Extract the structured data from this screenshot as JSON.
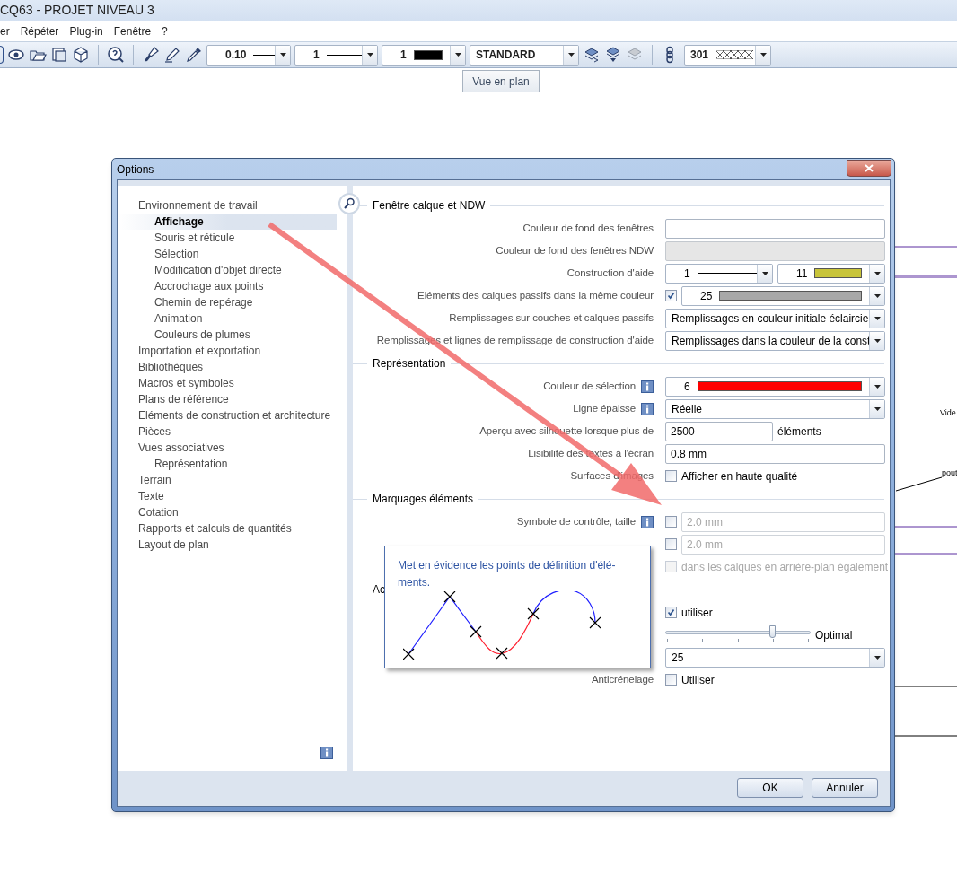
{
  "app": {
    "title": "CQ63 - PROJET NIVEAU 3"
  },
  "menu": [
    "er",
    "Répéter",
    "Plug-in",
    "Fenêtre",
    "?"
  ],
  "toolbar_combos": [
    {
      "value": "0.10",
      "line_sample": true
    },
    {
      "value": "1",
      "line_sample": true
    },
    {
      "value": "1",
      "color": "#000000"
    },
    {
      "value": "STANDARD"
    },
    {
      "value": "301",
      "hatched": true
    }
  ],
  "tooltip": {
    "text": "Vue en plan"
  },
  "canvas_labels": [
    "Vide",
    "pout"
  ],
  "dialog": {
    "title": "Options",
    "tree": [
      {
        "label": "Environnement de travail",
        "selected": false,
        "children": [
          {
            "label": "Affichage",
            "selected": true
          },
          {
            "label": "Souris et réticule",
            "selected": false
          },
          {
            "label": "Sélection",
            "selected": false
          },
          {
            "label": "Modification d'objet directe",
            "selected": false
          },
          {
            "label": "Accrochage aux points",
            "selected": false
          },
          {
            "label": "Chemin de repérage",
            "selected": false
          },
          {
            "label": "Animation",
            "selected": false
          },
          {
            "label": "Couleurs de plumes",
            "selected": false
          }
        ]
      },
      {
        "label": "Importation et exportation",
        "selected": false
      },
      {
        "label": "Bibliothèques",
        "selected": false
      },
      {
        "label": "Macros et symboles",
        "selected": false
      },
      {
        "label": "Plans de référence",
        "selected": false
      },
      {
        "label": "Eléments de construction et architecture",
        "selected": false
      },
      {
        "label": "Pièces",
        "selected": false
      },
      {
        "label": "Vues associatives",
        "selected": false,
        "children": [
          {
            "label": "Représentation",
            "selected": false
          }
        ]
      },
      {
        "label": "Terrain",
        "selected": false
      },
      {
        "label": "Texte",
        "selected": false
      },
      {
        "label": "Cotation",
        "selected": false
      },
      {
        "label": "Rapports et calculs de quantités",
        "selected": false
      },
      {
        "label": "Layout de plan",
        "selected": false
      }
    ],
    "sections": [
      {
        "title": "Fenêtre calque et NDW",
        "rows": [
          {
            "label": "Couleur de fond des fenêtres",
            "controls": [
              {
                "kind": "field",
                "disabled": false
              }
            ]
          },
          {
            "label": "Couleur de fond des fenêtres NDW",
            "controls": [
              {
                "kind": "field",
                "disabled": true
              }
            ]
          },
          {
            "label": "Construction d'aide",
            "controls": [
              {
                "kind": "combo",
                "value": "1",
                "line_sample": true
              },
              {
                "kind": "combo",
                "value": "11",
                "color": "#c8c43a"
              }
            ]
          },
          {
            "label": "Eléments des calques passifs dans la même couleur",
            "controls": [
              {
                "kind": "checkbox",
                "checked": true,
                "disabled": false
              },
              {
                "kind": "combo",
                "value": "25",
                "color": "#a8a8a8"
              }
            ]
          },
          {
            "label": "Remplissages sur couches et calques passifs",
            "controls": [
              {
                "kind": "combo",
                "value": "Remplissages en couleur initiale éclaircie"
              }
            ]
          },
          {
            "label": "Remplissages et lignes de remplissage de construction d'aide",
            "controls": [
              {
                "kind": "combo",
                "value": "Remplissages dans la couleur de la const"
              }
            ]
          }
        ]
      },
      {
        "title": "Représentation",
        "rows": [
          {
            "label": "Couleur de sélection",
            "info": true,
            "controls": [
              {
                "kind": "combo",
                "value": "6",
                "color": "#ff0000"
              }
            ]
          },
          {
            "label": "Ligne épaisse",
            "info": true,
            "controls": [
              {
                "kind": "combo",
                "value": "Réelle"
              }
            ]
          },
          {
            "label": "Aperçu avec silhouette lorsque plus de",
            "controls": [
              {
                "kind": "field",
                "value": "2500",
                "disabled": false
              },
              {
                "kind": "unit",
                "text": "éléments"
              }
            ]
          },
          {
            "label": "Lisibilité des textes à l'écran",
            "controls": [
              {
                "kind": "field",
                "value": "0.8 mm",
                "disabled": false
              }
            ]
          },
          {
            "label": "Surfaces d'images",
            "controls": [
              {
                "kind": "checkbox",
                "checked": false,
                "disabled": false,
                "text": "Afficher en haute qualité"
              }
            ]
          }
        ]
      },
      {
        "title": "Marquages éléments",
        "rows": [
          {
            "label": "Symbole de contrôle, taille",
            "info": true,
            "controls": [
              {
                "kind": "checkbox",
                "checked": false,
                "disabled": false
              },
              {
                "kind": "field",
                "value": "2.0 mm",
                "disabled": true
              }
            ]
          },
          {
            "controls": [
              {
                "kind": "checkbox",
                "checked": false,
                "disabled": false
              },
              {
                "kind": "field",
                "value": "2.0 mm",
                "disabled": true
              }
            ]
          },
          {
            "controls": [
              {
                "kind": "checkbox",
                "checked": false,
                "disabled": true,
                "text": "dans les calques en arrière-plan également"
              }
            ]
          }
        ]
      },
      {
        "title": "Ac",
        "rows": [
          {
            "controls": [
              {
                "kind": "checkbox",
                "checked": true,
                "disabled": false,
                "text": "utiliser"
              }
            ]
          },
          {
            "controls": [
              {
                "kind": "slider",
                "level": 0.75
              },
              {
                "kind": "unit",
                "text": "Optimal"
              }
            ]
          },
          {
            "controls": [
              {
                "kind": "combo",
                "value": "25"
              }
            ]
          },
          {
            "label": "Anticrénelage",
            "controls": [
              {
                "kind": "checkbox",
                "checked": false,
                "disabled": false,
                "text": "Utiliser"
              }
            ]
          }
        ]
      }
    ],
    "popup": {
      "text": "Met en évidence les points de définition d'élé-\nments."
    },
    "buttons": [
      "OK",
      "Annuler"
    ]
  }
}
